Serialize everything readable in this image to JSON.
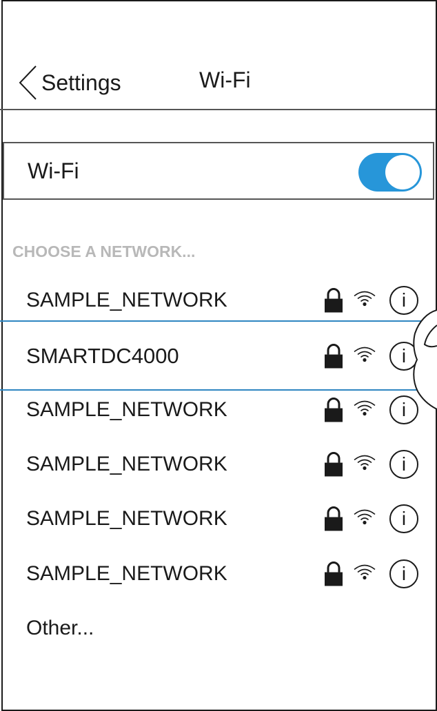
{
  "nav": {
    "back_label": "Settings",
    "title": "Wi-Fi"
  },
  "wifi_toggle": {
    "label": "Wi-Fi",
    "on": true,
    "color": "#2796d9"
  },
  "section_header": "CHOOSE A NETWORK...",
  "networks": [
    {
      "name": "SAMPLE_NETWORK",
      "secured": true,
      "info": "i"
    },
    {
      "name": "SMARTDC4000",
      "secured": true,
      "info": "i",
      "selected": true
    },
    {
      "name": "SAMPLE_NETWORK",
      "secured": true,
      "info": "i"
    },
    {
      "name": "SAMPLE_NETWORK",
      "secured": true,
      "info": "i"
    },
    {
      "name": "SAMPLE_NETWORK",
      "secured": true,
      "info": "i"
    },
    {
      "name": "SAMPLE_NETWORK",
      "secured": true,
      "info": "i"
    }
  ],
  "other_label": "Other...",
  "icons": {
    "back": "chevron-left-icon",
    "lock": "lock-icon",
    "signal": "wifi-signal-icon",
    "info": "info-icon"
  },
  "colors": {
    "selection_line": "#2e86c1",
    "section_header": "#b8b8b8"
  }
}
